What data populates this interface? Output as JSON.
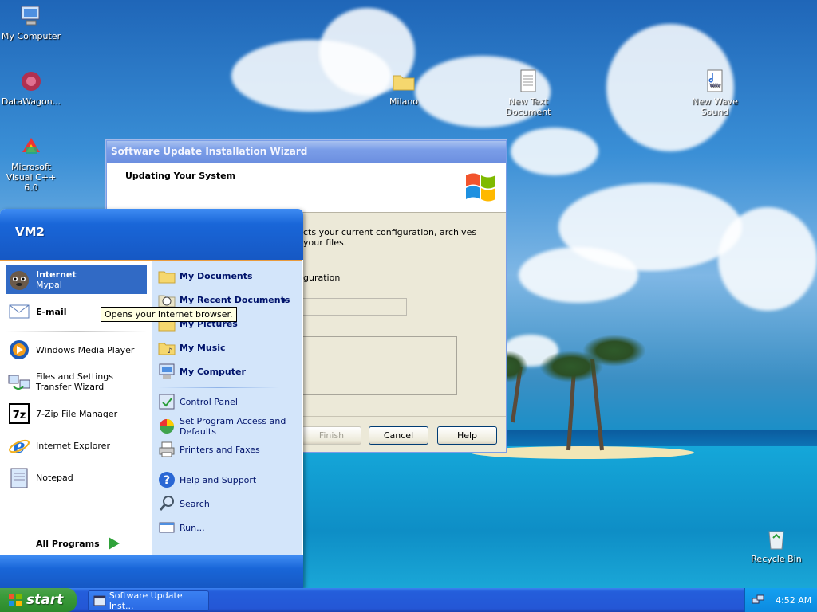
{
  "desktop": {
    "icons": [
      {
        "label": "My Computer",
        "icon": "my-computer-icon"
      },
      {
        "label": "DataWagon...",
        "icon": "datawagon-icon"
      },
      {
        "label": "Microsoft Visual C++ 6.0",
        "icon": "visual-cpp-icon"
      },
      {
        "label": "Milano",
        "icon": "folder-icon"
      },
      {
        "label": "New Text Document",
        "icon": "text-document-icon"
      },
      {
        "label": "New Wave Sound",
        "icon": "wave-sound-icon"
      },
      {
        "label": "Recycle Bin",
        "icon": "recycle-bin-icon"
      }
    ]
  },
  "wizard": {
    "title": "Software Update Installation Wizard",
    "header": "Updating Your System",
    "body_line1": "cts your current configuration, archives",
    "body_line2": "your files.",
    "body_line3": "guration",
    "buttons": {
      "finish": "Finish",
      "cancel": "Cancel",
      "help": "Help"
    }
  },
  "start_menu": {
    "user": "VM2",
    "pinned": [
      {
        "title": "Internet",
        "subtitle": "Mypal",
        "icon": "mypal-icon"
      },
      {
        "title": "E-mail",
        "icon": "email-icon"
      }
    ],
    "recent": [
      {
        "label": "Windows Media Player",
        "icon": "media-player-icon"
      },
      {
        "label": "Files and Settings Transfer Wizard",
        "icon": "transfer-wizard-icon"
      },
      {
        "label": "7-Zip File Manager",
        "icon": "7zip-icon"
      },
      {
        "label": "Internet Explorer",
        "icon": "ie-icon"
      },
      {
        "label": "Notepad",
        "icon": "notepad-icon"
      }
    ],
    "all_programs": "All Programs",
    "places": [
      {
        "label": "My Documents",
        "icon": "my-documents-icon"
      },
      {
        "label": "My Recent Documents",
        "icon": "recent-documents-icon"
      },
      {
        "label": "My Pictures",
        "icon": "my-pictures-icon"
      },
      {
        "label": "My Music",
        "icon": "my-music-icon"
      },
      {
        "label": "My Computer",
        "icon": "my-computer-icon"
      }
    ],
    "system": [
      {
        "label": "Control Panel",
        "icon": "control-panel-icon"
      },
      {
        "label": "Set Program Access and Defaults",
        "icon": "program-access-icon"
      },
      {
        "label": "Printers and Faxes",
        "icon": "printer-icon"
      }
    ],
    "help": [
      {
        "label": "Help and Support",
        "icon": "help-icon"
      },
      {
        "label": "Search",
        "icon": "search-icon"
      },
      {
        "label": "Run...",
        "icon": "run-icon"
      }
    ]
  },
  "tooltip": "Opens your Internet browser.",
  "taskbar": {
    "start": "start",
    "task": "Software Update Inst...",
    "clock": "4:52 AM"
  }
}
